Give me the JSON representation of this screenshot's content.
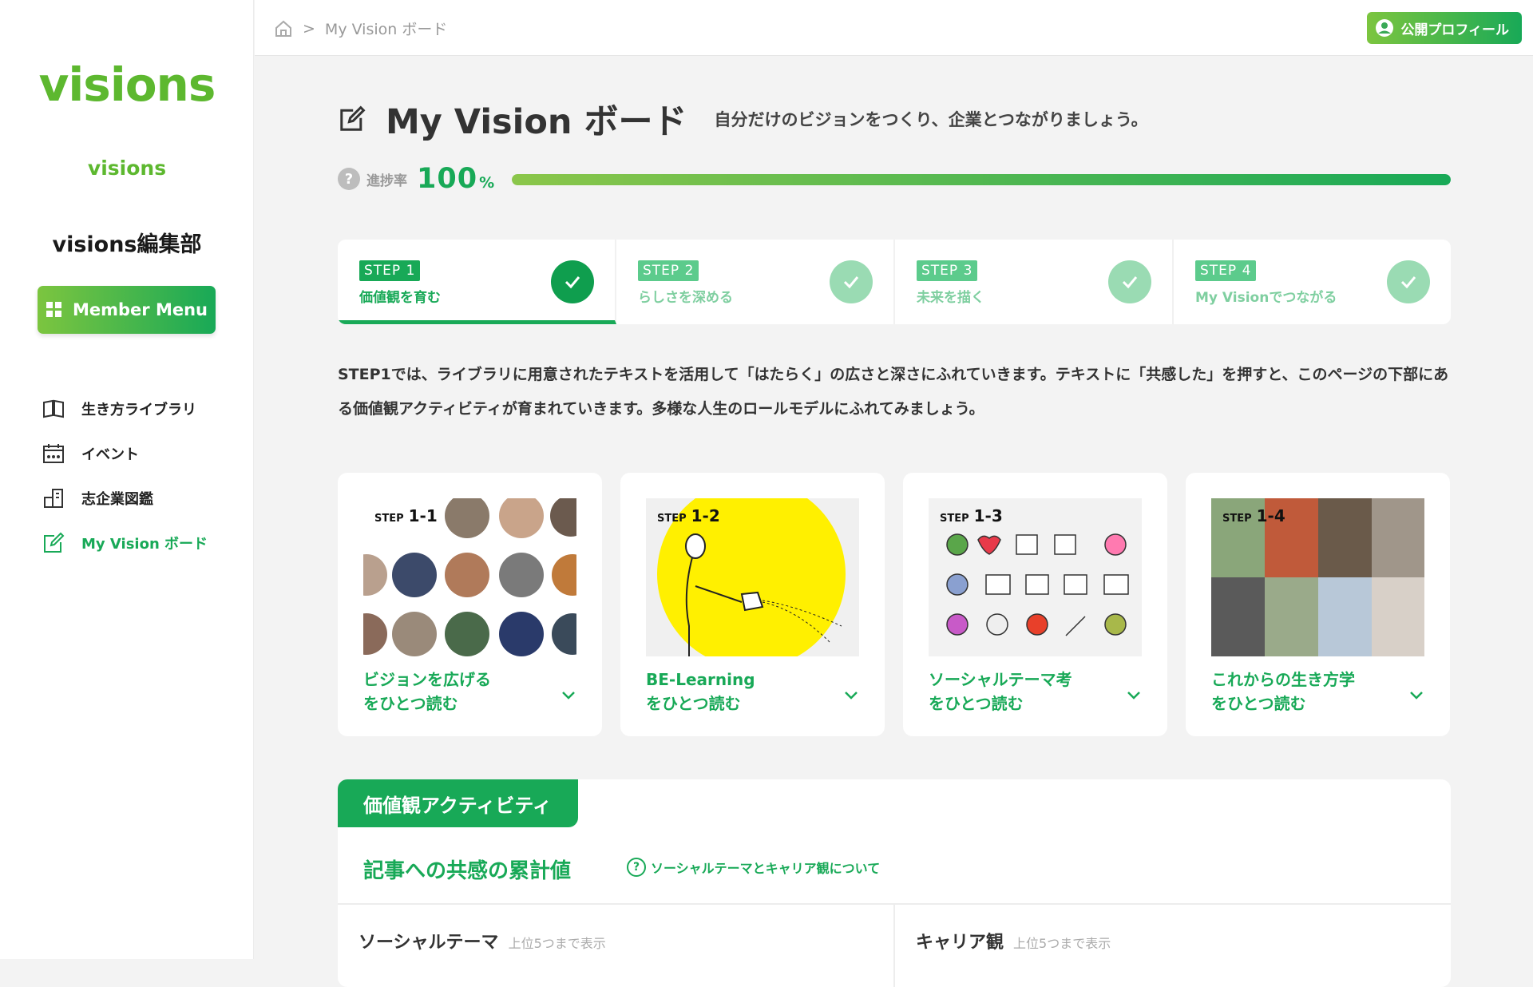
{
  "sidebar": {
    "logo": "visions",
    "sublogo": "visions",
    "org_name": "visions編集部",
    "member_menu": "Member Menu",
    "nav": [
      {
        "label": "生き方ライブラリ",
        "icon": "book-icon"
      },
      {
        "label": "イベント",
        "icon": "calendar-icon"
      },
      {
        "label": "志企業図鑑",
        "icon": "building-icon"
      },
      {
        "label": "My Vision ボード",
        "icon": "edit-icon"
      }
    ]
  },
  "topbar": {
    "breadcrumb_current": "My Vision ボード",
    "profile_button": "公開プロフィール"
  },
  "page": {
    "title": "My Vision ボード",
    "subtitle": "自分だけのビジョンをつくり、企業とつながりましょう。",
    "progress_label": "進捗率",
    "progress_value": "100",
    "progress_unit": "%",
    "progress_fraction": 1.0
  },
  "steps": [
    {
      "badge": "STEP 1",
      "title": "価値観を育む",
      "done": true,
      "active": true
    },
    {
      "badge": "STEP 2",
      "title": "らしさを深める",
      "done": true,
      "active": false
    },
    {
      "badge": "STEP 3",
      "title": "未来を描く",
      "done": true,
      "active": false
    },
    {
      "badge": "STEP 4",
      "title": "My Visionでつながる",
      "done": true,
      "active": false
    }
  ],
  "description": "STEP1では、ライブラリに用意されたテキストを活用して「はたらく」の広さと深さにふれていきます。テキストに「共感した」を押すと、このページの下部にある価値観アクティビティが育まれていきます。多様な人生のロールモデルにふれてみましょう。",
  "cards": [
    {
      "step_prefix": "STEP",
      "step_num": "1-1",
      "line1": "ビジョンを広げる",
      "line2": "をひとつ読む"
    },
    {
      "step_prefix": "STEP",
      "step_num": "1-2",
      "line1": "BE-Learning",
      "line2": "をひとつ読む"
    },
    {
      "step_prefix": "STEP",
      "step_num": "1-3",
      "line1": "ソーシャルテーマ考",
      "line2": "をひとつ読む"
    },
    {
      "step_prefix": "STEP",
      "step_num": "1-4",
      "line1": "これからの生き方学",
      "line2": "をひとつ読む"
    }
  ],
  "activity": {
    "tab": "価値観アクティビティ",
    "heading": "記事への共感の累計値",
    "help_link": "ソーシャルテーマとキャリア観について",
    "col1_title": "ソーシャルテーマ",
    "col1_note": "上位5つまで表示",
    "col2_title": "キャリア観",
    "col2_note": "上位5つまで表示"
  },
  "colors": {
    "brand": "#18a957",
    "brand_light": "#7cc53f",
    "logo": "#5db82f"
  }
}
